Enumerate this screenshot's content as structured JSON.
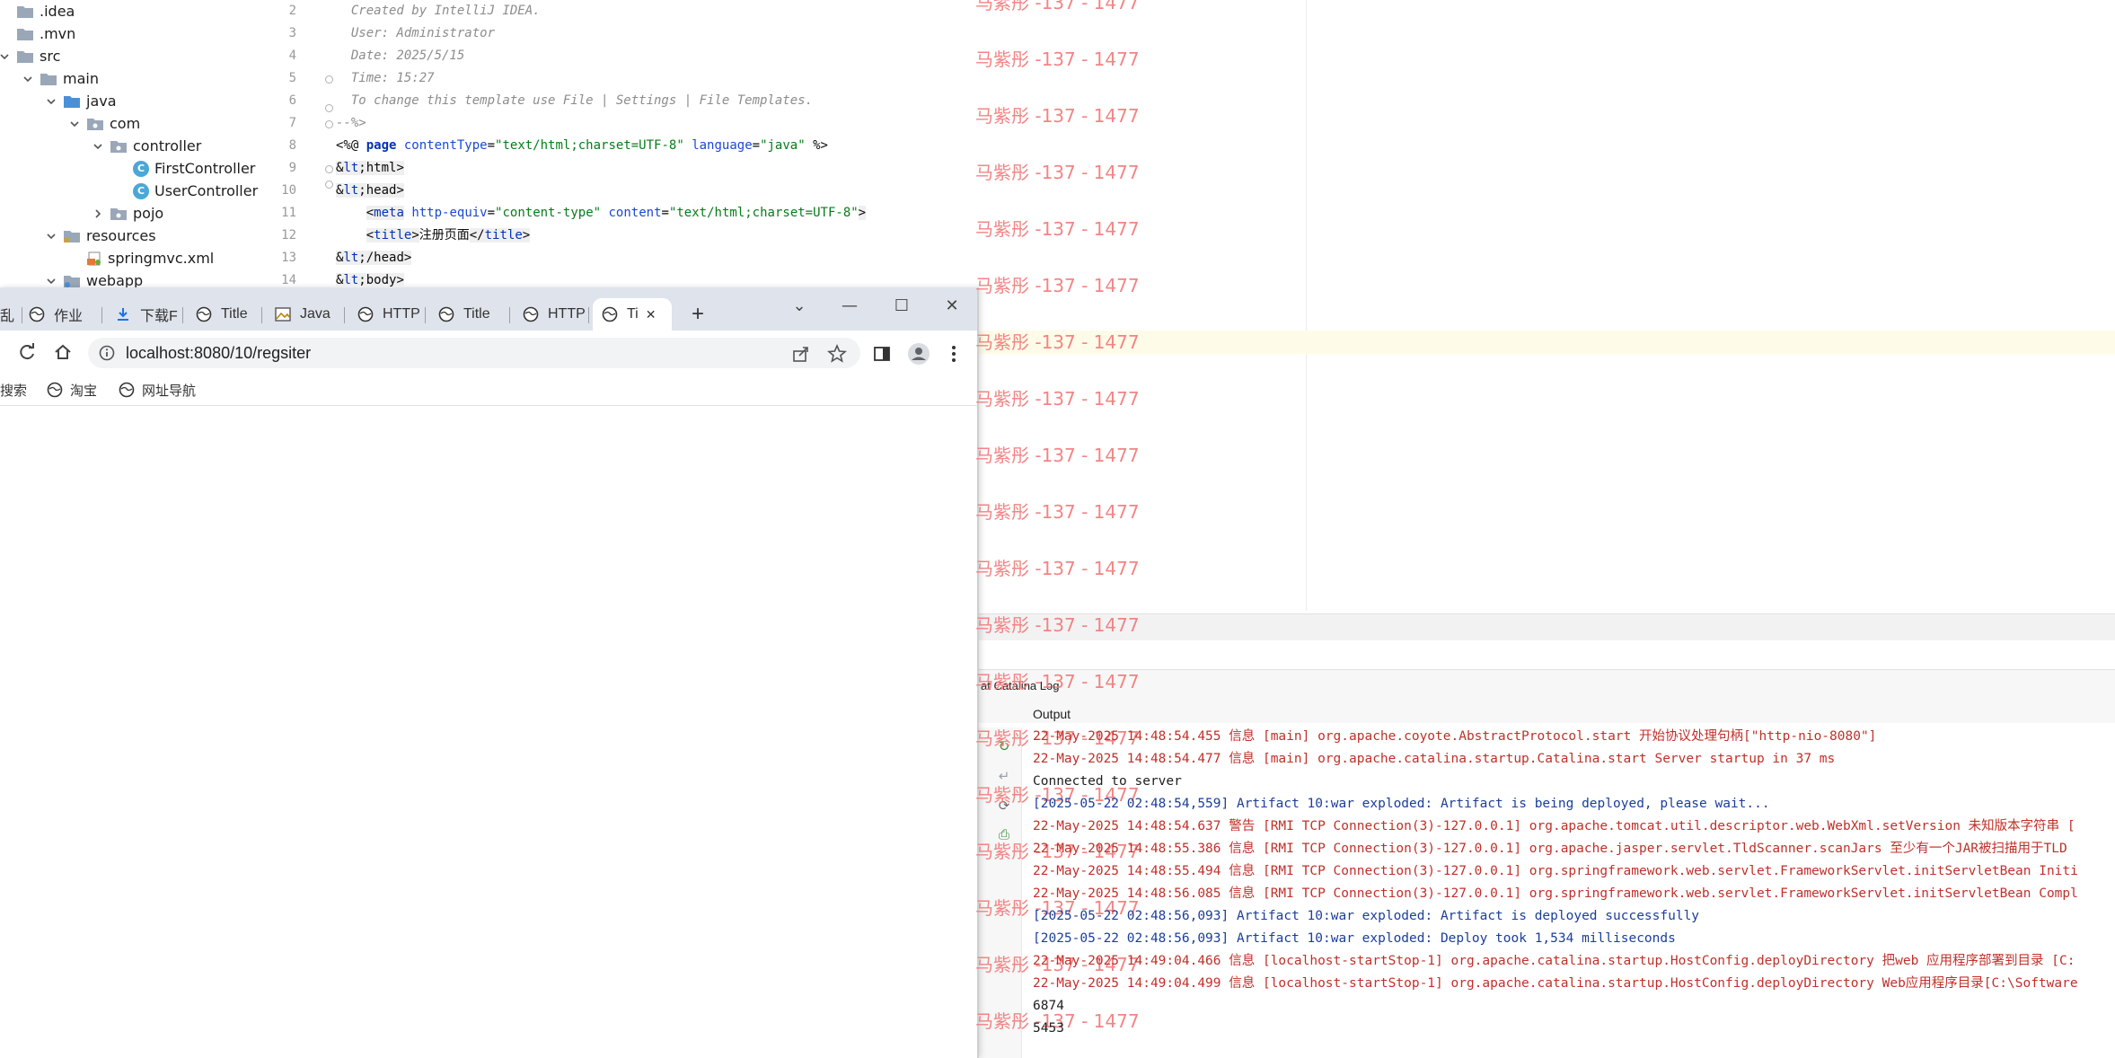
{
  "project_tree": {
    "items": [
      {
        "label": ".idea",
        "indent": 0,
        "kind": "folder",
        "expanded": null
      },
      {
        "label": ".mvn",
        "indent": 0,
        "kind": "folder",
        "expanded": null
      },
      {
        "label": "src",
        "indent": 0,
        "kind": "folder",
        "expanded": true
      },
      {
        "label": "main",
        "indent": 1,
        "kind": "folder",
        "expanded": true
      },
      {
        "label": "java",
        "indent": 2,
        "kind": "source-folder",
        "expanded": true
      },
      {
        "label": "com",
        "indent": 3,
        "kind": "package",
        "expanded": true
      },
      {
        "label": "controller",
        "indent": 4,
        "kind": "package",
        "expanded": true
      },
      {
        "label": "FirstController",
        "indent": 5,
        "kind": "class",
        "expanded": null
      },
      {
        "label": "UserController",
        "indent": 5,
        "kind": "class",
        "expanded": null
      },
      {
        "label": "pojo",
        "indent": 4,
        "kind": "package",
        "expanded": false
      },
      {
        "label": "resources",
        "indent": 2,
        "kind": "resource-folder",
        "expanded": true
      },
      {
        "label": "springmvc.xml",
        "indent": 3,
        "kind": "xml",
        "expanded": null
      },
      {
        "label": "webapp",
        "indent": 2,
        "kind": "web-folder",
        "expanded": true
      }
    ]
  },
  "editor": {
    "lines": [
      {
        "n": "2",
        "text": "  Created by IntelliJ IDEA."
      },
      {
        "n": "3",
        "text": "  User: Administrator"
      },
      {
        "n": "4",
        "text": "  Date: 2025/5/15"
      },
      {
        "n": "5",
        "text": "  Time: 15:27"
      },
      {
        "n": "6",
        "text": "  To change this template use File | Settings | File Templates."
      },
      {
        "n": "7",
        "text": "--%>"
      },
      {
        "n": "8",
        "text": "<%@ page contentType=\"text/html;charset=UTF-8\" language=\"java\" %>"
      },
      {
        "n": "9",
        "text": "<html>"
      },
      {
        "n": "10",
        "text": "<head>"
      },
      {
        "n": "11",
        "text": "    <meta http-equiv=\"content-type\" content=\"text/html;charset=UTF-8\">"
      },
      {
        "n": "12",
        "text": "    <title>注册页面</title>"
      },
      {
        "n": "13",
        "text": "</head>"
      },
      {
        "n": "14",
        "text": "<body>"
      }
    ]
  },
  "browser": {
    "tabs": [
      {
        "label": "乱"
      },
      {
        "label": "作业"
      },
      {
        "label": "下载F"
      },
      {
        "label": "Title"
      },
      {
        "label": "Java"
      },
      {
        "label": "HTTP"
      },
      {
        "label": "Title"
      },
      {
        "label": "HTTP"
      },
      {
        "label": "Ti"
      }
    ],
    "new_tab": "+",
    "url": "localhost:8080/10/regsiter",
    "bookmarks": [
      {
        "label": "搜索"
      },
      {
        "label": "淘宝"
      },
      {
        "label": "网址导航"
      }
    ],
    "window_controls": {
      "dropdown": "⌄",
      "minimize": "—",
      "maximize": "☐",
      "close": "✕"
    }
  },
  "run_panel": {
    "log_tab": "at Catalina Log",
    "output_label": "Output",
    "lines": [
      {
        "text": "22-May-2025 14:48:54.455 信息 [main] org.apache.coyote.AbstractProtocol.start 开始协议处理句柄[\"http-nio-8080\"]",
        "style": "red"
      },
      {
        "text": "22-May-2025 14:48:54.477 信息 [main] org.apache.catalina.startup.Catalina.start Server startup in 37 ms",
        "style": "red"
      },
      {
        "text": "Connected to server",
        "style": "black"
      },
      {
        "text": "[2025-05-22 02:48:54,559] Artifact 10:war exploded: Artifact is being deployed, please wait...",
        "style": "blue"
      },
      {
        "text": "22-May-2025 14:48:54.637 警告 [RMI TCP Connection(3)-127.0.0.1] org.apache.tomcat.util.descriptor.web.WebXml.setVersion 未知版本字符串 [",
        "style": "red"
      },
      {
        "text": "22-May-2025 14:48:55.386 信息 [RMI TCP Connection(3)-127.0.0.1] org.apache.jasper.servlet.TldScanner.scanJars 至少有一个JAR被扫描用于TLD",
        "style": "red"
      },
      {
        "text": "22-May-2025 14:48:55.494 信息 [RMI TCP Connection(3)-127.0.0.1] org.springframework.web.servlet.FrameworkServlet.initServletBean Initi",
        "style": "red"
      },
      {
        "text": "22-May-2025 14:48:56.085 信息 [RMI TCP Connection(3)-127.0.0.1] org.springframework.web.servlet.FrameworkServlet.initServletBean Compl",
        "style": "red"
      },
      {
        "text": "[2025-05-22 02:48:56,093] Artifact 10:war exploded: Artifact is deployed successfully",
        "style": "blue"
      },
      {
        "text": "[2025-05-22 02:48:56,093] Artifact 10:war exploded: Deploy took 1,534 milliseconds",
        "style": "blue"
      },
      {
        "text": "22-May-2025 14:49:04.466 信息 [localhost-startStop-1] org.apache.catalina.startup.HostConfig.deployDirectory 把web 应用程序部署到目录 [C:",
        "style": "red"
      },
      {
        "text": "22-May-2025 14:49:04.499 信息 [localhost-startStop-1] org.apache.catalina.startup.HostConfig.deployDirectory Web应用程序目录[C:\\Software",
        "style": "red"
      },
      {
        "text": "6874",
        "style": "black"
      },
      {
        "text": "5453",
        "style": "black"
      }
    ]
  },
  "watermark": {
    "text": "马紫彤 -137 - 1477",
    "color": "#f37a7a"
  },
  "colors": {
    "tab_strip": "#dfe3ec",
    "caret_line": "#fefbe8",
    "log_red": "#c0302a",
    "log_blue": "#1b3e9a"
  }
}
